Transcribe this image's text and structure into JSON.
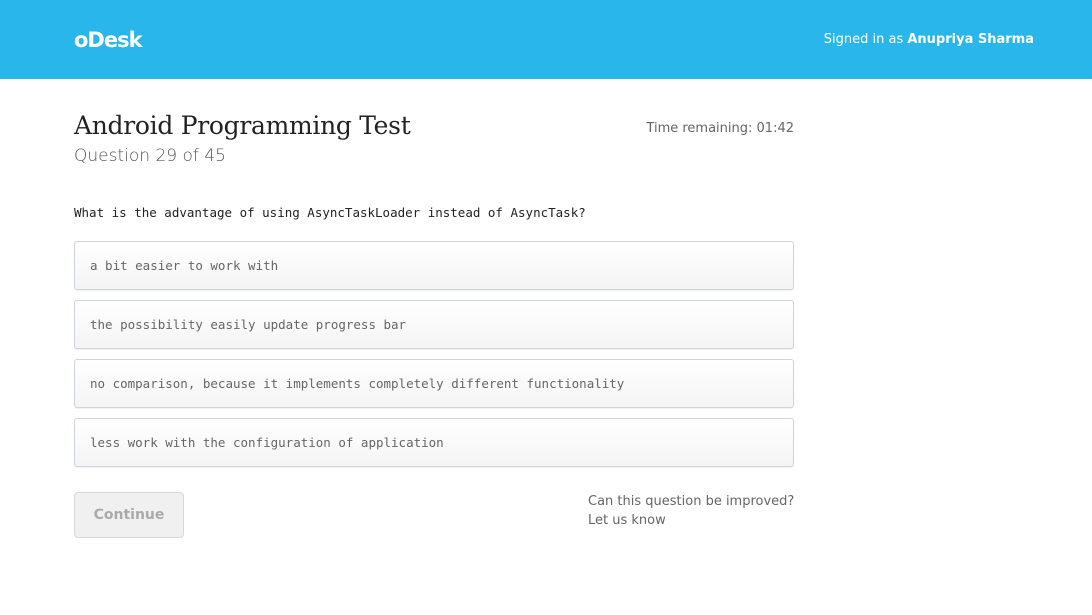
{
  "header": {
    "logo_text": "oDesk",
    "signed_in_prefix": "Signed in as ",
    "user_name": "Anupriya Sharma",
    "background_color": "#29b6ea"
  },
  "test": {
    "title": "Android Programming Test",
    "progress": "Question 29 of 45",
    "timer_label": "Time remaining: ",
    "timer_value": "01:42"
  },
  "question": {
    "text": "What is the advantage of using AsyncTaskLoader instead of AsyncTask?",
    "options": [
      {
        "label": "a bit easier to work with"
      },
      {
        "label": "the possibility easily update progress bar"
      },
      {
        "label": "no comparison, because it implements completely different functionality"
      },
      {
        "label": "less work with the configuration of application"
      }
    ]
  },
  "actions": {
    "continue_label": "Continue",
    "continue_disabled": true
  },
  "feedback": {
    "prompt": "Can this question be improved?",
    "link_label": "Let us know"
  }
}
